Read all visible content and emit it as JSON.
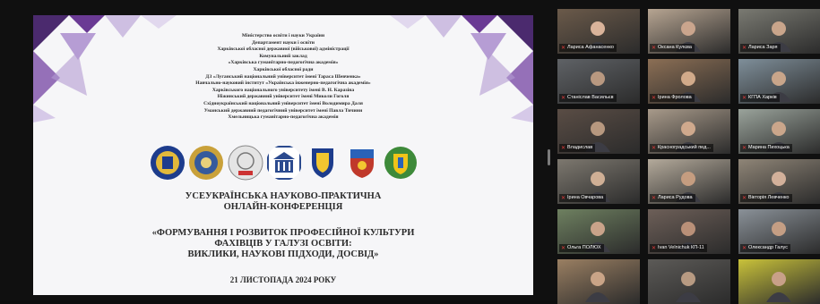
{
  "slide": {
    "header_lines": [
      "Міністерство освіти і науки України",
      "Департамент науки і освіти",
      "Харківської обласної державної (військової) адміністрації",
      "Комунальний заклад",
      "«Харківська гуманітарно-педагогічна академія»",
      "Харківської обласної ради",
      "ДЗ «Луганський національний університет імені Тараса Шевченка»",
      "Навчально-науковий інститут «Українська інженерно-педагогічна академія»",
      "Харківського національного університету імені В. Н. Каразіна",
      "Ніжинський державний університет імені Миколи Гоголя",
      "Східноукраїнський національний університет імені Володимира Даля",
      "Уманський державний педагогічний університет імені Павла Тичини",
      "Хмельницька гуманітарно-педагогічна академія"
    ],
    "title_lines": [
      "УСЕУКРАЇНСЬКА НАУКОВО-ПРАКТИЧНА",
      "ОНЛАЙН-КОНФЕРЕНЦІЯ"
    ],
    "theme_lines": [
      "«ФОРМУВАННЯ І РОЗВИТОК ПРОФЕСІЙНОЇ КУЛЬТУРИ",
      "ФАХІВЦІВ У ГАЛУЗІ ОСВІТИ:",
      "ВИКЛИКИ, НАУКОВІ ПІДХОДИ, ДОСВІД»"
    ],
    "date": "21 ЛИСТОПАДА 2024 РОКУ",
    "logos": [
      "university-emblem",
      "academy-seal",
      "puha-logo",
      "building-logo",
      "shield-logo",
      "coat-of-arms",
      "regional-emblem"
    ]
  },
  "participants": [
    {
      "name": "Лариса Афанасенко",
      "bg": "#6b5a4a",
      "skin": "#d9b39a",
      "active": false
    },
    {
      "name": "Оксана Кулєва",
      "bg": "#b7a592",
      "skin": "#caa58d",
      "active": false
    },
    {
      "name": "Лариса Заря",
      "bg": "#7a7a72",
      "skin": "#c9a58b",
      "active": false
    },
    {
      "name": "Станіслав Васильєв",
      "bg": "#5f6266",
      "skin": "#b89880",
      "active": false
    },
    {
      "name": "Ірина Фролова",
      "bg": "#8c6f55",
      "skin": "#d1aa8a",
      "active": false
    },
    {
      "name": "КГПА Харків",
      "bg": "#7f8f9a",
      "skin": "#c8a58a",
      "active": true
    },
    {
      "name": "Владислав",
      "bg": "#5a4d45",
      "skin": "#b7987f",
      "active": false
    },
    {
      "name": "Красноградський пед...",
      "bg": "#a89a8a",
      "skin": "#cfa98d",
      "active": false
    },
    {
      "name": "Марина Пихоцька",
      "bg": "#9aa39b",
      "skin": "#caa68b",
      "active": false
    },
    {
      "name": "Ірина Овчарова",
      "bg": "#7d786f",
      "skin": "#cfaf95",
      "active": false
    },
    {
      "name": "Лариса Рудова",
      "bg": "#b4aa9b",
      "skin": "#c59d80",
      "active": false
    },
    {
      "name": "Вікторія Левченко",
      "bg": "#8f8577",
      "skin": "#d2b09a",
      "active": false
    },
    {
      "name": "Ольга ПОЛЮХ",
      "bg": "#6e8060",
      "skin": "#c9a38a",
      "active": false
    },
    {
      "name": "Ivan Velnichuk КП-11",
      "bg": "#6d5f58",
      "skin": "#b99078",
      "active": false
    },
    {
      "name": "Олександр Галус",
      "bg": "#8a9198",
      "skin": "#c49e84",
      "active": false
    },
    {
      "name": "",
      "bg": "#9a7f62",
      "skin": "#c9a487",
      "active": false
    },
    {
      "name": "",
      "bg": "#5c5a57",
      "skin": "#b79a82",
      "active": false
    },
    {
      "name": "",
      "bg": "#c9c23a",
      "skin": "#c8a088",
      "active": false
    }
  ]
}
